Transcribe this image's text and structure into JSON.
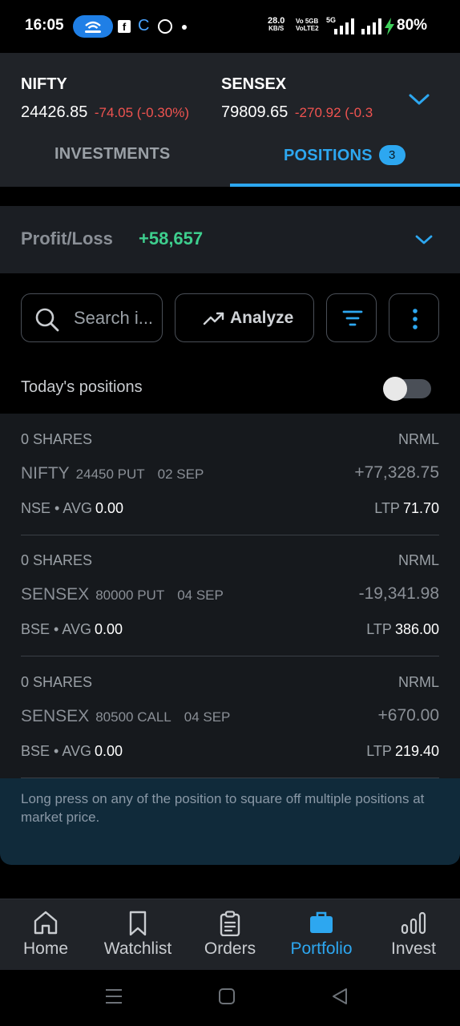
{
  "status_bar": {
    "time": "16:05",
    "net_speed_value": "28.0",
    "net_speed_unit": "KB/S",
    "volte_line1": "Vo 5GB",
    "volte_line2": "VoLTE2",
    "net_type": "5G",
    "battery": "80%",
    "fb_glyph": "f",
    "c_glyph": "C"
  },
  "indices": [
    {
      "name": "NIFTY",
      "value": "24426.85",
      "change": "-74.05 (-0.30%)"
    },
    {
      "name": "SENSEX",
      "value": "79809.65",
      "change": "-270.92 (-0.3"
    }
  ],
  "tabs": {
    "investments": "INVESTMENTS",
    "positions": "POSITIONS",
    "positions_count": "3"
  },
  "pnl": {
    "label": "Profit/Loss",
    "value": "+58,657"
  },
  "toolbar": {
    "search_placeholder": "Search i...",
    "analyze_label": "Analyze"
  },
  "today_positions": {
    "label": "Today's positions",
    "enabled": false
  },
  "positions": [
    {
      "shares": "0 SHARES",
      "product": "NRML",
      "symbol": "NIFTY",
      "strike": "24450 PUT",
      "expiry": "02 SEP",
      "pnl": "+77,328.75",
      "exchange": "NSE",
      "avg_label": "AVG",
      "avg": "0.00",
      "ltp_label": "LTP",
      "ltp": "71.70"
    },
    {
      "shares": "0 SHARES",
      "product": "NRML",
      "symbol": "SENSEX",
      "strike": "80000 PUT",
      "expiry": "04 SEP",
      "pnl": "-19,341.98",
      "exchange": "BSE",
      "avg_label": "AVG",
      "avg": "0.00",
      "ltp_label": "LTP",
      "ltp": "386.00"
    },
    {
      "shares": "0 SHARES",
      "product": "NRML",
      "symbol": "SENSEX",
      "strike": "80500 CALL",
      "expiry": "04 SEP",
      "pnl": "+670.00",
      "exchange": "BSE",
      "avg_label": "AVG",
      "avg": "0.00",
      "ltp_label": "LTP",
      "ltp": "219.40"
    }
  ],
  "info_text": "Long press on any of the position to square off multiple positions at market price.",
  "bottom_nav": [
    {
      "label": "Home",
      "icon": "home-icon"
    },
    {
      "label": "Watchlist",
      "icon": "bookmark-icon"
    },
    {
      "label": "Orders",
      "icon": "clipboard-icon"
    },
    {
      "label": "Portfolio",
      "icon": "briefcase-icon",
      "active": true
    },
    {
      "label": "Invest",
      "icon": "bar-chart-icon"
    }
  ],
  "colors": {
    "accent": "#2da7f0",
    "negative": "#ef5350",
    "positive": "#3ecf8e"
  }
}
